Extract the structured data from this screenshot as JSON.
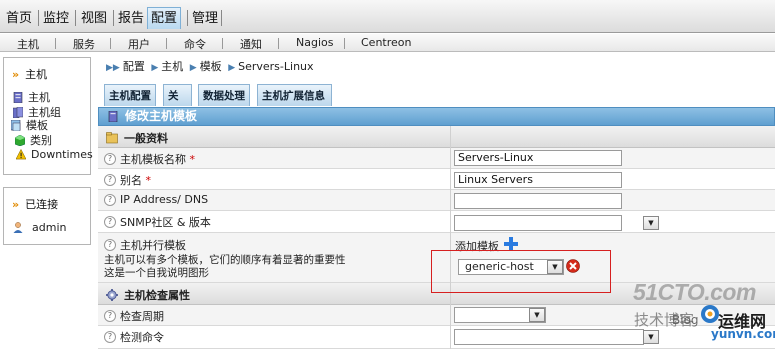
{
  "topnav": {
    "items": [
      "首页",
      "监控",
      "视图",
      "报告",
      "配置",
      "管理"
    ],
    "active": "配置"
  },
  "subnav": {
    "items": [
      "主机",
      "服务",
      "用户",
      "命令",
      "通知",
      "Nagios",
      "Centreon"
    ]
  },
  "sidebar": {
    "host_title": "主机",
    "items": [
      "主机",
      "主机组",
      "模板",
      "类别",
      "Downtimes"
    ],
    "connected_title": "已连接",
    "user": "admin"
  },
  "breadcrumb": [
    "配置",
    "主机",
    "模板",
    "Servers-Linux"
  ],
  "tabs": [
    "主机配置",
    "关系",
    "数据处理",
    "主机扩展信息"
  ],
  "form": {
    "title": "修改主机模板",
    "section_general": "一般资料",
    "name_label": "主机模板名称",
    "name_value": "Servers-Linux",
    "alias_label": "别名",
    "alias_value": "Linux Servers",
    "ip_label": "IP Address/ DNS",
    "ip_value": "",
    "snmp_label": "SNMP社区 & 版本",
    "parallel_label": "主机并行模板",
    "parallel_desc1": "主机可以有多个模板，它们的顺序有着显著的重要性",
    "parallel_desc2": "这是一个自我说明图形",
    "add_template": "添加模板",
    "template_selected": "generic-host",
    "section_check": "主机检查属性",
    "check_period_label": "检查周期",
    "check_cmd_label": "检测命令"
  },
  "watermark": {
    "brand": "51CTO.com",
    "sub": "技术博客",
    "blog": "Blog",
    "site": "运维网",
    "url": "yunvn.com"
  }
}
